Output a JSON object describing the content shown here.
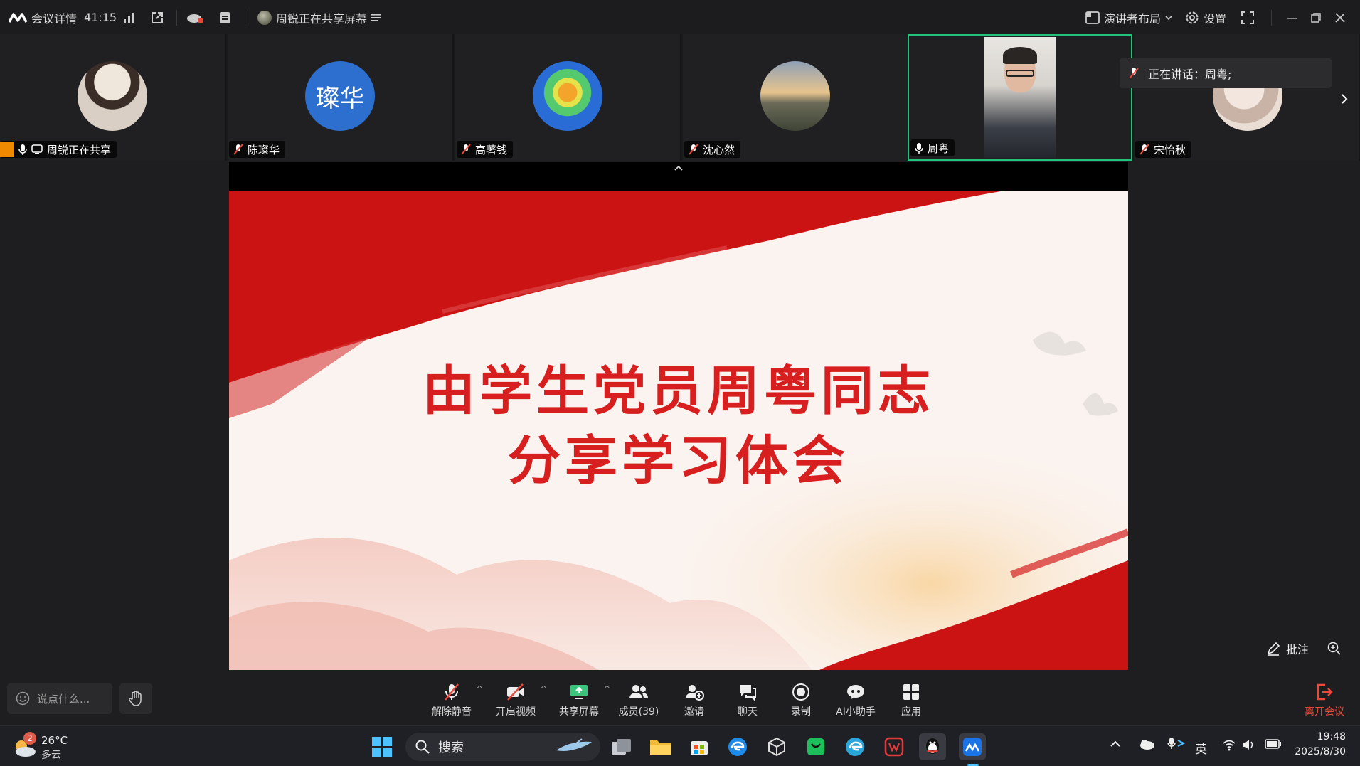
{
  "titlebar": {
    "meeting_details": "会议详情",
    "timer": "41:15",
    "sharing_status": "周锐正在共享屏幕",
    "layout": "演讲者布局",
    "settings": "设置"
  },
  "participants": [
    {
      "name": "周锐正在共享",
      "mic": "on",
      "sharing": true
    },
    {
      "name": "陈璨华",
      "avatar_text": "璨华",
      "avatar_color": "#2c6fcf",
      "mic": "muted"
    },
    {
      "name": "高著钱",
      "mic": "muted"
    },
    {
      "name": "沈心然",
      "mic": "muted"
    },
    {
      "name": "周粤",
      "mic": "on",
      "speaking": true
    },
    {
      "name": "宋怡秋",
      "mic": "muted"
    }
  ],
  "speaking_tip": "正在讲话：周粤;",
  "slide": {
    "line1": "由学生党员周粤同志",
    "line2": "分享学习体会",
    "accent_color": "#d71f1f"
  },
  "annotate": {
    "label": "批注"
  },
  "bottombar": {
    "chat_placeholder": "说点什么...",
    "tools": [
      {
        "label": "解除静音",
        "icon": "mic-off-icon"
      },
      {
        "label": "开启视频",
        "icon": "video-off-icon"
      },
      {
        "label": "共享屏幕",
        "icon": "share-screen-icon"
      },
      {
        "label": "成员(39)",
        "icon": "members-icon"
      },
      {
        "label": "邀请",
        "icon": "invite-icon"
      },
      {
        "label": "聊天",
        "icon": "chat-icon"
      },
      {
        "label": "录制",
        "icon": "record-icon"
      },
      {
        "label": "AI小助手",
        "icon": "ai-assistant-icon"
      },
      {
        "label": "应用",
        "icon": "apps-icon"
      }
    ],
    "leave": "离开会议"
  },
  "taskbar": {
    "weather_temp": "26°C",
    "weather_desc": "多云",
    "weather_badge": "2",
    "search": "搜索",
    "ime": "英",
    "time": "19:48",
    "date": "2025/8/30"
  }
}
